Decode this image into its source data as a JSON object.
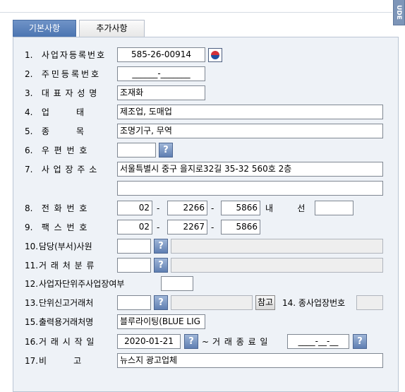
{
  "side_tab": {
    "label": "UDE"
  },
  "tabs": [
    {
      "label": "기본사항",
      "active": true
    },
    {
      "label": "추가사항",
      "active": false
    }
  ],
  "form": {
    "row1": {
      "num": "1.",
      "label": "사업자등록번호",
      "value": "585-26-00914"
    },
    "row2": {
      "num": "2.",
      "label": "주민등록번호",
      "value": "______-_______"
    },
    "row3": {
      "num": "3.",
      "label": "대 표 자 성 명",
      "value": "조재화"
    },
    "row4": {
      "num": "4.",
      "label": "업          태",
      "value": "제조업, 도매업"
    },
    "row5": {
      "num": "5.",
      "label": "종          목",
      "value": "조명기구, 무역"
    },
    "row6": {
      "num": "6.",
      "label": "우 편 번 호",
      "value": ""
    },
    "row7": {
      "num": "7.",
      "label": "사 업 장 주 소",
      "value": "서울특별시 중구 을지로32길 35-32 560호 2층",
      "value2": ""
    },
    "row8": {
      "num": "8.",
      "label": "전 화 번 호",
      "p1": "02",
      "p2": "2266",
      "p3": "5866",
      "ext_label": "내         선",
      "ext": ""
    },
    "row9": {
      "num": "9.",
      "label": "팩 스 번 호",
      "p1": "02",
      "p2": "2267",
      "p3": "5866"
    },
    "row10": {
      "num": "10.",
      "label": "담당(부서)사원",
      "value": "",
      "name": ""
    },
    "row11": {
      "num": "11.",
      "label": "거 래 처 분 류",
      "value": "",
      "name": ""
    },
    "row12": {
      "num": "12.",
      "label": "사업자단위주사업장여부",
      "value": ""
    },
    "row13": {
      "num": "13.",
      "label": "단위신고거래처",
      "value": "",
      "name": "",
      "ref_btn": "참고",
      "sub_num": "14.",
      "sub_label": "종사업장번호",
      "sub_value": ""
    },
    "row15": {
      "num": "15.",
      "label": "출력용거래처명",
      "value": "블루라이팅(BLUE LIG"
    },
    "row16": {
      "num": "16.",
      "label": "거 래 시 작 일",
      "value": "2020-01-21",
      "tilde": "~",
      "end_label": "거 래 종 료 일",
      "end_value": "____-__-__"
    },
    "row17": {
      "num": "17.",
      "label": "비          고",
      "value": "뉴스지 광고업체"
    }
  },
  "icons": {
    "help": "question-mark-icon",
    "gov": "government-emblem-icon"
  },
  "colors": {
    "panel_bg": "#eef2f7",
    "active_tab": "#4a73b0",
    "help_btn": "#5f7fb2"
  }
}
